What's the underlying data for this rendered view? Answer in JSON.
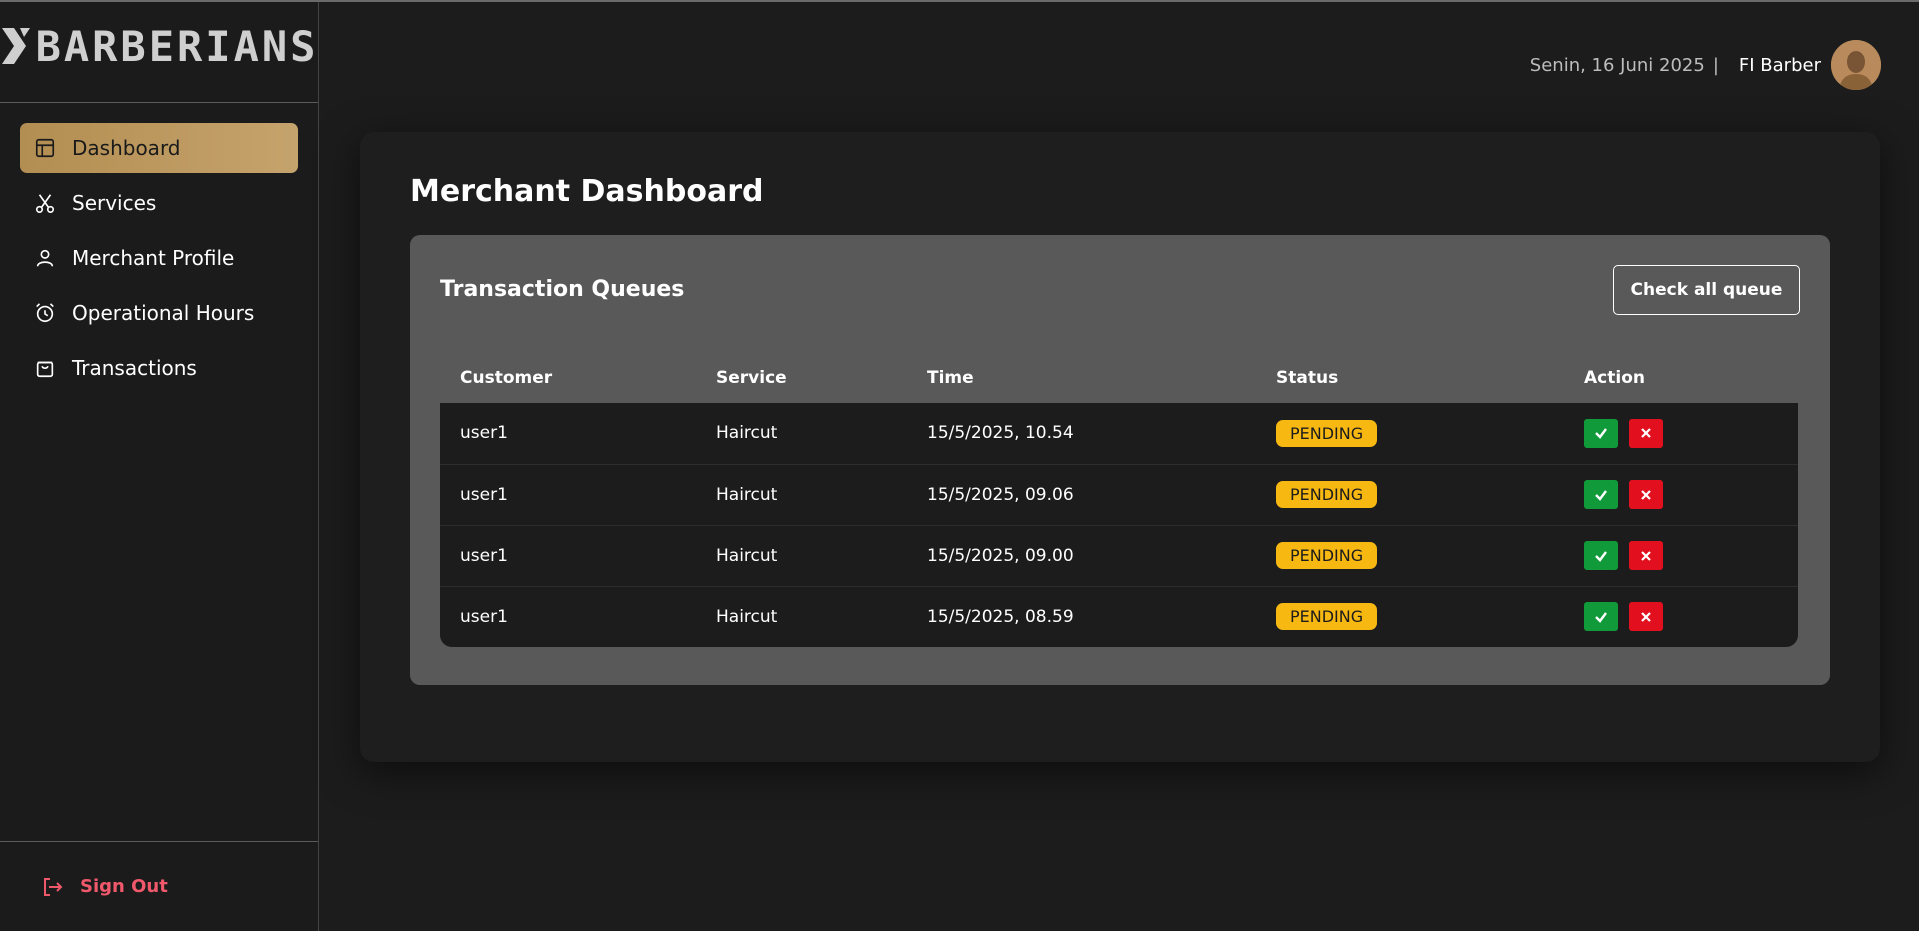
{
  "brand": {
    "name": "BARBERIANS"
  },
  "sidebar": {
    "items": [
      {
        "label": "Dashboard",
        "icon": "layout-icon",
        "active": true
      },
      {
        "label": "Services",
        "icon": "scissors-icon",
        "active": false
      },
      {
        "label": "Merchant Profile",
        "icon": "user-icon",
        "active": false
      },
      {
        "label": "Operational Hours",
        "icon": "alarm-clock-icon",
        "active": false
      },
      {
        "label": "Transactions",
        "icon": "shopping-bag-icon",
        "active": false
      }
    ],
    "signout_label": "Sign Out"
  },
  "header": {
    "date": "Senin, 16 Juni 2025",
    "separator": "|",
    "username": "FI Barber"
  },
  "page": {
    "title": "Merchant Dashboard"
  },
  "queue": {
    "title": "Transaction Queues",
    "check_all_label": "Check all queue",
    "columns": [
      "Customer",
      "Service",
      "Time",
      "Status",
      "Action"
    ],
    "rows": [
      {
        "customer": "user1",
        "service": "Haircut",
        "time": "15/5/2025, 10.54",
        "status": "PENDING"
      },
      {
        "customer": "user1",
        "service": "Haircut",
        "time": "15/5/2025, 09.06",
        "status": "PENDING"
      },
      {
        "customer": "user1",
        "service": "Haircut",
        "time": "15/5/2025, 09.00",
        "status": "PENDING"
      },
      {
        "customer": "user1",
        "service": "Haircut",
        "time": "15/5/2025, 08.59",
        "status": "PENDING"
      }
    ]
  },
  "colors": {
    "accent": "#c5a36c",
    "pending": "#f8b812",
    "accept": "#109a3a",
    "reject": "#e2101e",
    "signout": "#f0586b"
  }
}
